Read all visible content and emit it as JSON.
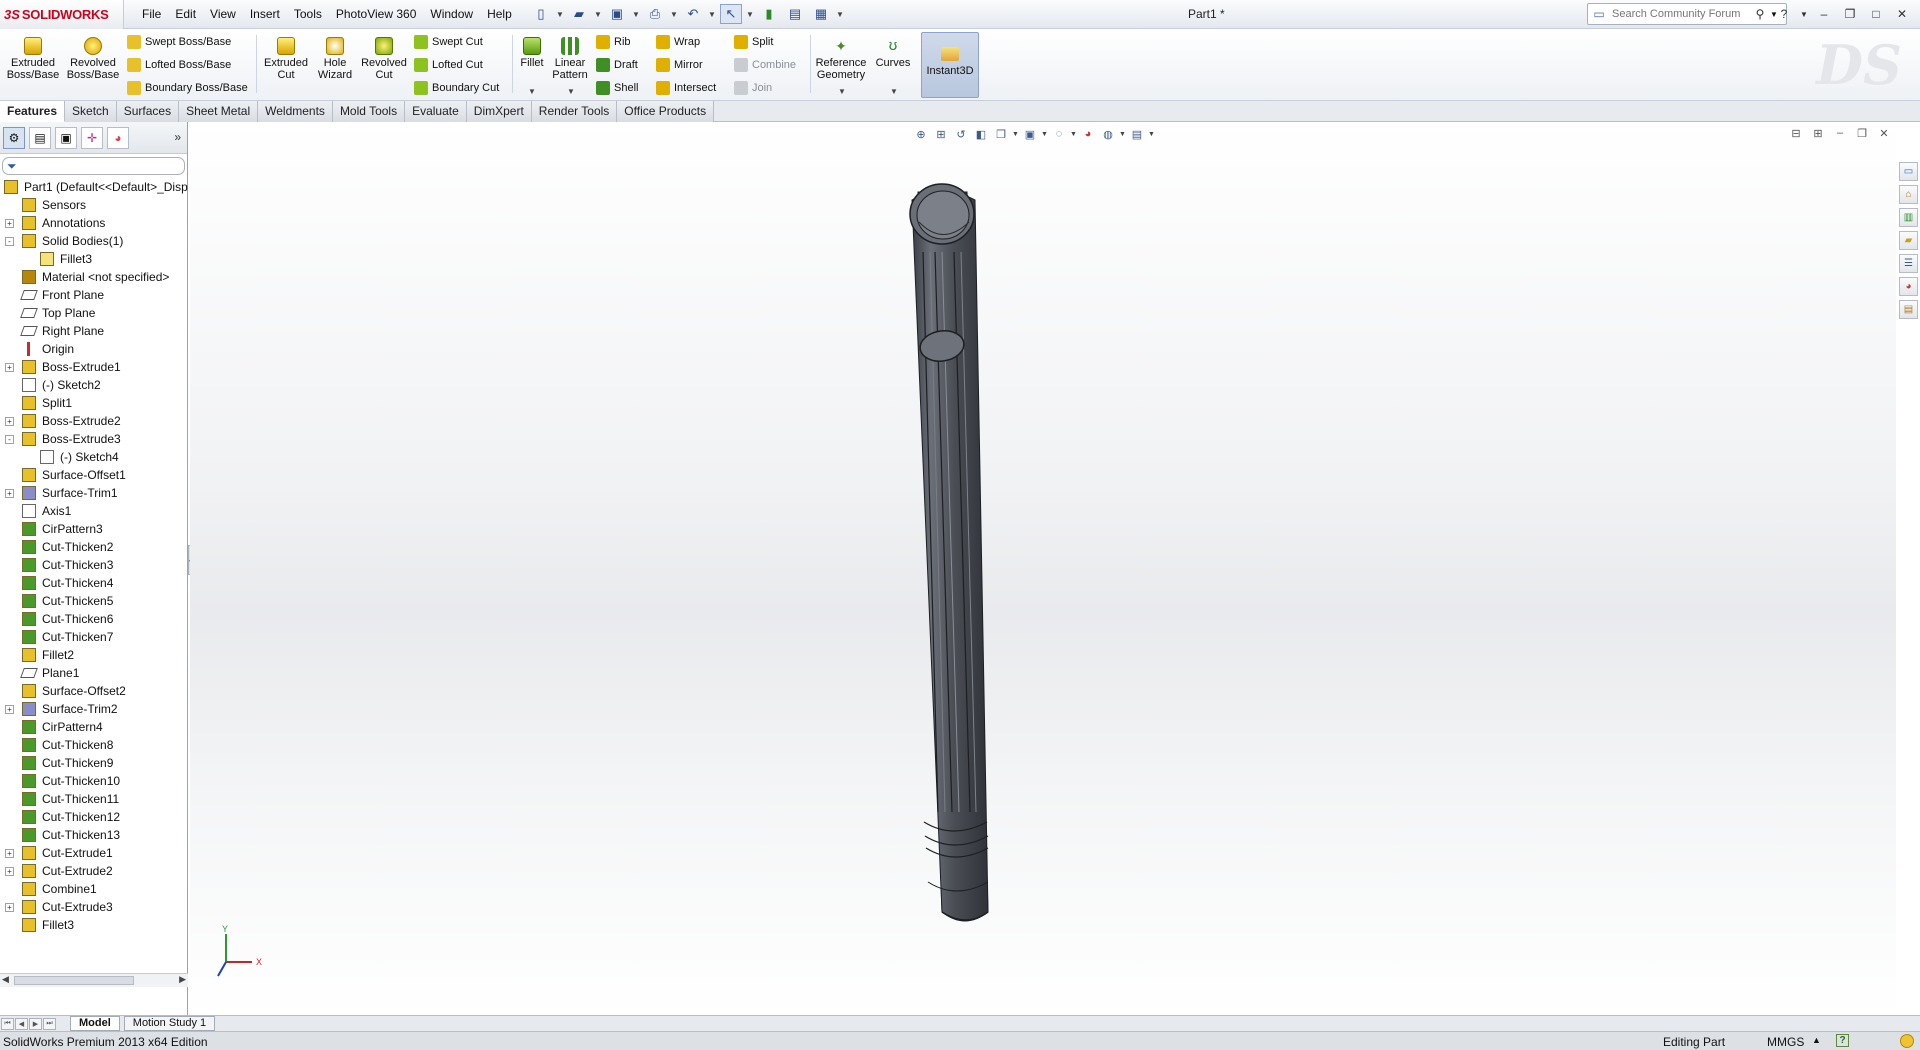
{
  "app": {
    "logo_prefix": "3S",
    "logo_text": "SOLIDWORKS",
    "document_title": "Part1 *",
    "accent": "#d0021b"
  },
  "menu": [
    "File",
    "Edit",
    "View",
    "Insert",
    "Tools",
    "PhotoView 360",
    "Window",
    "Help"
  ],
  "search": {
    "placeholder": "Search Community Forum"
  },
  "ribbon": {
    "extruded_boss": "Extruded Boss/Base",
    "revolved_boss": "Revolved Boss/Base",
    "swept_boss": "Swept Boss/Base",
    "lofted_boss": "Lofted Boss/Base",
    "boundary_boss": "Boundary Boss/Base",
    "extruded_cut": "Extruded Cut",
    "hole_wizard": "Hole Wizard",
    "revolved_cut": "Revolved Cut",
    "swept_cut": "Swept Cut",
    "lofted_cut": "Lofted Cut",
    "boundary_cut": "Boundary Cut",
    "fillet": "Fillet",
    "linear_pattern": "Linear Pattern",
    "rib": "Rib",
    "draft": "Draft",
    "shell": "Shell",
    "wrap": "Wrap",
    "mirror": "Mirror",
    "intersect": "Intersect",
    "split": "Split",
    "combine": "Combine",
    "join": "Join",
    "reference_geometry": "Reference Geometry",
    "curves": "Curves",
    "instant3d": "Instant3D"
  },
  "tabs": [
    {
      "label": "Features",
      "active": true
    },
    {
      "label": "Sketch"
    },
    {
      "label": "Surfaces"
    },
    {
      "label": "Sheet Metal"
    },
    {
      "label": "Weldments"
    },
    {
      "label": "Mold Tools"
    },
    {
      "label": "Evaluate"
    },
    {
      "label": "DimXpert"
    },
    {
      "label": "Render Tools"
    },
    {
      "label": "Office Products"
    }
  ],
  "tree": [
    {
      "label": "Part1  (Default<<Default>_Disp",
      "icon": "part-icon",
      "indent": 0,
      "expander": ""
    },
    {
      "label": "Sensors",
      "icon": "sensor-folder-icon",
      "indent": 1,
      "expander": ""
    },
    {
      "label": "Annotations",
      "icon": "annotations-icon",
      "indent": 1,
      "expander": "+"
    },
    {
      "label": "Solid Bodies(1)",
      "icon": "solid-bodies-folder-icon",
      "indent": 1,
      "expander": "-"
    },
    {
      "label": "Fillet3",
      "icon": "solid-body-icon",
      "indent": 2,
      "expander": ""
    },
    {
      "label": "Material <not specified>",
      "icon": "material-icon",
      "indent": 1,
      "expander": ""
    },
    {
      "label": "Front Plane",
      "icon": "plane-icon",
      "indent": 1,
      "expander": ""
    },
    {
      "label": "Top Plane",
      "icon": "plane-icon",
      "indent": 1,
      "expander": ""
    },
    {
      "label": "Right Plane",
      "icon": "plane-icon",
      "indent": 1,
      "expander": ""
    },
    {
      "label": "Origin",
      "icon": "origin-icon",
      "indent": 1,
      "expander": ""
    },
    {
      "label": "Boss-Extrude1",
      "icon": "extrude-icon",
      "indent": 1,
      "expander": "+"
    },
    {
      "label": "(-) Sketch2",
      "icon": "sketch-icon",
      "indent": 1,
      "expander": ""
    },
    {
      "label": "Split1",
      "icon": "split-icon",
      "indent": 1,
      "expander": ""
    },
    {
      "label": "Boss-Extrude2",
      "icon": "extrude-icon",
      "indent": 1,
      "expander": "+"
    },
    {
      "label": "Boss-Extrude3",
      "icon": "extrude-icon",
      "indent": 1,
      "expander": "-"
    },
    {
      "label": "(-) Sketch4",
      "icon": "sketch-icon",
      "indent": 2,
      "expander": ""
    },
    {
      "label": "Surface-Offset1",
      "icon": "surface-offset-icon",
      "indent": 1,
      "expander": ""
    },
    {
      "label": "Surface-Trim1",
      "icon": "surface-trim-icon",
      "indent": 1,
      "expander": "+"
    },
    {
      "label": "Axis1",
      "icon": "axis-icon",
      "indent": 1,
      "expander": ""
    },
    {
      "label": "CirPattern3",
      "icon": "circular-pattern-icon",
      "indent": 1,
      "expander": ""
    },
    {
      "label": "Cut-Thicken2",
      "icon": "cut-thicken-icon",
      "indent": 1,
      "expander": ""
    },
    {
      "label": "Cut-Thicken3",
      "icon": "cut-thicken-icon",
      "indent": 1,
      "expander": ""
    },
    {
      "label": "Cut-Thicken4",
      "icon": "cut-thicken-icon",
      "indent": 1,
      "expander": ""
    },
    {
      "label": "Cut-Thicken5",
      "icon": "cut-thicken-icon",
      "indent": 1,
      "expander": ""
    },
    {
      "label": "Cut-Thicken6",
      "icon": "cut-thicken-icon",
      "indent": 1,
      "expander": ""
    },
    {
      "label": "Cut-Thicken7",
      "icon": "cut-thicken-icon",
      "indent": 1,
      "expander": ""
    },
    {
      "label": "Fillet2",
      "icon": "fillet-icon",
      "indent": 1,
      "expander": ""
    },
    {
      "label": "Plane1",
      "icon": "plane-icon",
      "indent": 1,
      "expander": ""
    },
    {
      "label": "Surface-Offset2",
      "icon": "surface-offset-icon",
      "indent": 1,
      "expander": ""
    },
    {
      "label": "Surface-Trim2",
      "icon": "surface-trim-icon",
      "indent": 1,
      "expander": "+"
    },
    {
      "label": "CirPattern4",
      "icon": "circular-pattern-icon",
      "indent": 1,
      "expander": ""
    },
    {
      "label": "Cut-Thicken8",
      "icon": "cut-thicken-icon",
      "indent": 1,
      "expander": ""
    },
    {
      "label": "Cut-Thicken9",
      "icon": "cut-thicken-icon",
      "indent": 1,
      "expander": ""
    },
    {
      "label": "Cut-Thicken10",
      "icon": "cut-thicken-icon",
      "indent": 1,
      "expander": ""
    },
    {
      "label": "Cut-Thicken11",
      "icon": "cut-thicken-icon",
      "indent": 1,
      "expander": ""
    },
    {
      "label": "Cut-Thicken12",
      "icon": "cut-thicken-icon",
      "indent": 1,
      "expander": ""
    },
    {
      "label": "Cut-Thicken13",
      "icon": "cut-thicken-icon",
      "indent": 1,
      "expander": ""
    },
    {
      "label": "Cut-Extrude1",
      "icon": "cut-extrude-icon",
      "indent": 1,
      "expander": "+"
    },
    {
      "label": "Cut-Extrude2",
      "icon": "cut-extrude-icon",
      "indent": 1,
      "expander": "+"
    },
    {
      "label": "Combine1",
      "icon": "combine-icon",
      "indent": 1,
      "expander": ""
    },
    {
      "label": "Cut-Extrude3",
      "icon": "cut-extrude-icon",
      "indent": 1,
      "expander": "+"
    },
    {
      "label": "Fillet3",
      "icon": "fillet-icon",
      "indent": 1,
      "expander": ""
    }
  ],
  "bottom_tabs": [
    {
      "label": "Model",
      "active": true
    },
    {
      "label": "Motion Study 1"
    }
  ],
  "status": {
    "edition": "SolidWorks Premium 2013 x64 Edition",
    "editing": "Editing Part",
    "units": "MMGS",
    "units_arrow": "▲",
    "help": "?"
  },
  "triad": {
    "x": "X",
    "y": "Y"
  }
}
